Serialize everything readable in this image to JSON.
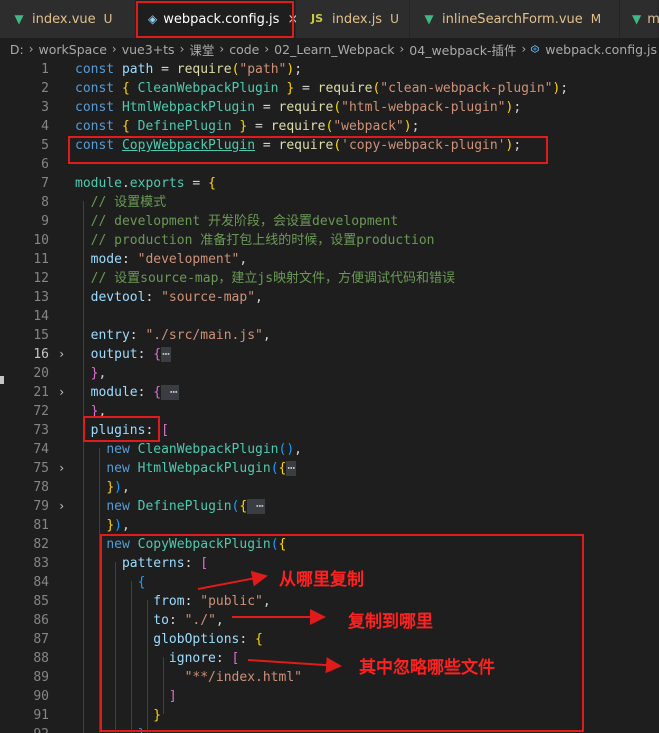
{
  "tabs": [
    {
      "icon": "vue-icon",
      "glyph": "▼",
      "color": "#41b883",
      "name": "index.vue",
      "badge": "U",
      "active": false
    },
    {
      "icon": "webpack-icon",
      "glyph": "◈",
      "color": "#8ed6fb",
      "name": "webpack.config.js",
      "badge": "",
      "close": "×",
      "active": true
    },
    {
      "icon": "js-icon",
      "glyph": "JS",
      "color": "#cbcb41",
      "name": "index.js",
      "badge": "U",
      "active": false
    },
    {
      "icon": "vue-icon",
      "glyph": "▼",
      "color": "#41b883",
      "name": "inlineSearchForm.vue",
      "badge": "M",
      "active": false
    },
    {
      "icon": "vue-icon",
      "glyph": "▼",
      "color": "#41b883",
      "name": "m",
      "badge": "",
      "active": false
    }
  ],
  "breadcrumb": [
    "D:",
    "workSpace",
    "vue3+ts",
    "课堂",
    "code",
    "02_Learn_Webpack",
    "04_webpack-插件",
    "webpack.config.js"
  ],
  "editor": {
    "lines": [
      {
        "n": "1",
        "tokens": [
          [
            "kw",
            "const "
          ],
          [
            "var",
            "path"
          ],
          [
            "pl",
            " = "
          ],
          [
            "fn",
            "require"
          ],
          [
            "br1",
            "("
          ],
          [
            "str",
            "\"path\""
          ],
          [
            "br1",
            ")"
          ],
          [
            "pl",
            ";"
          ]
        ]
      },
      {
        "n": "2",
        "tokens": [
          [
            "kw",
            "const "
          ],
          [
            "br1",
            "{ "
          ],
          [
            "cls",
            "CleanWebpackPlugin"
          ],
          [
            "br1",
            " }"
          ],
          [
            "pl",
            " = "
          ],
          [
            "fn",
            "require"
          ],
          [
            "br1",
            "("
          ],
          [
            "str",
            "\"clean-webpack-plugin\""
          ],
          [
            "br1",
            ")"
          ],
          [
            "pl",
            ";"
          ]
        ]
      },
      {
        "n": "3",
        "tokens": [
          [
            "kw",
            "const "
          ],
          [
            "cls",
            "HtmlWebpackPlugin"
          ],
          [
            "pl",
            " = "
          ],
          [
            "fn",
            "require"
          ],
          [
            "br1",
            "("
          ],
          [
            "str",
            "\"html-webpack-plugin\""
          ],
          [
            "br1",
            ")"
          ],
          [
            "pl",
            ";"
          ]
        ]
      },
      {
        "n": "4",
        "tokens": [
          [
            "kw",
            "const "
          ],
          [
            "br1",
            "{ "
          ],
          [
            "cls",
            "DefinePlugin"
          ],
          [
            "br1",
            " }"
          ],
          [
            "pl",
            " = "
          ],
          [
            "fn",
            "require"
          ],
          [
            "br1",
            "("
          ],
          [
            "str",
            "\"webpack\""
          ],
          [
            "br1",
            ")"
          ],
          [
            "pl",
            ";"
          ]
        ]
      },
      {
        "n": "5",
        "tokens": [
          [
            "kw",
            "const "
          ],
          [
            "cls ul",
            "CopyWebpackPlugin"
          ],
          [
            "pl",
            " = "
          ],
          [
            "fn",
            "require"
          ],
          [
            "br1",
            "("
          ],
          [
            "str",
            "'copy-webpack-plugin'"
          ],
          [
            "br1",
            ")"
          ],
          [
            "pl",
            ";"
          ]
        ]
      },
      {
        "n": "6",
        "tokens": []
      },
      {
        "n": "7",
        "tokens": [
          [
            "cls",
            "module"
          ],
          [
            "pl",
            "."
          ],
          [
            "cls",
            "exports"
          ],
          [
            "pl",
            " = "
          ],
          [
            "br1",
            "{"
          ]
        ]
      },
      {
        "n": "8",
        "tokens": [
          [
            "pl",
            "  "
          ],
          [
            "cm",
            "// 设置模式"
          ]
        ]
      },
      {
        "n": "9",
        "tokens": [
          [
            "pl",
            "  "
          ],
          [
            "cm",
            "// development 开发阶段，会设置development"
          ]
        ]
      },
      {
        "n": "10",
        "tokens": [
          [
            "pl",
            "  "
          ],
          [
            "cm",
            "// production 准备打包上线的时候，设置production"
          ]
        ]
      },
      {
        "n": "11",
        "tokens": [
          [
            "pl",
            "  "
          ],
          [
            "var",
            "mode"
          ],
          [
            "pl",
            ": "
          ],
          [
            "str",
            "\"development\""
          ],
          [
            "pl",
            ","
          ]
        ]
      },
      {
        "n": "12",
        "tokens": [
          [
            "pl",
            "  "
          ],
          [
            "cm",
            "// 设置source-map，建立js映射文件，方便调试代码和错误"
          ]
        ]
      },
      {
        "n": "13",
        "tokens": [
          [
            "pl",
            "  "
          ],
          [
            "var",
            "devtool"
          ],
          [
            "pl",
            ": "
          ],
          [
            "str",
            "\"source-map\""
          ],
          [
            "pl",
            ","
          ]
        ]
      },
      {
        "n": "14",
        "tokens": []
      },
      {
        "n": "15",
        "tokens": [
          [
            "pl",
            "  "
          ],
          [
            "var",
            "entry"
          ],
          [
            "pl",
            ": "
          ],
          [
            "str",
            "\"./src/main.js\""
          ],
          [
            "pl",
            ","
          ]
        ]
      },
      {
        "n": "16",
        "cur": true,
        "fold": true,
        "tokens": [
          [
            "pl",
            "  "
          ],
          [
            "var",
            "output"
          ],
          [
            "pl",
            ": "
          ],
          [
            "br2",
            "{"
          ],
          [
            "ell",
            "⋯"
          ]
        ]
      },
      {
        "n": "20",
        "tokens": [
          [
            "pl",
            "  "
          ],
          [
            "br2",
            "}"
          ],
          [
            "pl",
            ","
          ]
        ]
      },
      {
        "n": "21",
        "fold": true,
        "tokens": [
          [
            "pl",
            "  "
          ],
          [
            "var",
            "module"
          ],
          [
            "pl",
            ": "
          ],
          [
            "br2",
            "{"
          ],
          [
            "ell",
            " ⋯"
          ]
        ]
      },
      {
        "n": "72",
        "tokens": [
          [
            "pl",
            "  "
          ],
          [
            "br2",
            "}"
          ],
          [
            "pl",
            ","
          ]
        ]
      },
      {
        "n": "73",
        "tokens": [
          [
            "pl",
            "  "
          ],
          [
            "var",
            "plugins"
          ],
          [
            "pl",
            ": "
          ],
          [
            "br2",
            "["
          ]
        ]
      },
      {
        "n": "74",
        "tokens": [
          [
            "pl",
            "    "
          ],
          [
            "kw",
            "new "
          ],
          [
            "cls",
            "CleanWebpackPlugin"
          ],
          [
            "br3",
            "()"
          ],
          [
            "pl",
            ","
          ]
        ]
      },
      {
        "n": "75",
        "fold": true,
        "tokens": [
          [
            "pl",
            "    "
          ],
          [
            "kw",
            "new "
          ],
          [
            "cls",
            "HtmlWebpackPlugin"
          ],
          [
            "br3",
            "("
          ],
          [
            "br1",
            "{"
          ],
          [
            "ell",
            "⋯"
          ]
        ]
      },
      {
        "n": "78",
        "tokens": [
          [
            "pl",
            "    "
          ],
          [
            "br1",
            "}"
          ],
          [
            "br3",
            ")"
          ],
          [
            "pl",
            ","
          ]
        ]
      },
      {
        "n": "79",
        "fold": true,
        "tokens": [
          [
            "pl",
            "    "
          ],
          [
            "kw",
            "new "
          ],
          [
            "cls",
            "DefinePlugin"
          ],
          [
            "br3",
            "("
          ],
          [
            "br1",
            "{"
          ],
          [
            "ell",
            " ⋯"
          ]
        ]
      },
      {
        "n": "81",
        "tokens": [
          [
            "pl",
            "    "
          ],
          [
            "br1",
            "}"
          ],
          [
            "br3",
            ")"
          ],
          [
            "pl",
            ","
          ]
        ]
      },
      {
        "n": "82",
        "tokens": [
          [
            "pl",
            "    "
          ],
          [
            "kw",
            "new "
          ],
          [
            "cls",
            "CopyWebpackPlugin"
          ],
          [
            "br3",
            "("
          ],
          [
            "br1",
            "{"
          ]
        ]
      },
      {
        "n": "83",
        "tokens": [
          [
            "pl",
            "      "
          ],
          [
            "var",
            "patterns"
          ],
          [
            "pl",
            ": "
          ],
          [
            "br2",
            "["
          ]
        ]
      },
      {
        "n": "84",
        "tokens": [
          [
            "pl",
            "        "
          ],
          [
            "br3",
            "{"
          ]
        ]
      },
      {
        "n": "85",
        "tokens": [
          [
            "pl",
            "          "
          ],
          [
            "var",
            "from"
          ],
          [
            "pl",
            ": "
          ],
          [
            "str",
            "\"public\""
          ],
          [
            "pl",
            ","
          ]
        ]
      },
      {
        "n": "86",
        "tokens": [
          [
            "pl",
            "          "
          ],
          [
            "var",
            "to"
          ],
          [
            "pl",
            ": "
          ],
          [
            "str",
            "\"./\""
          ],
          [
            "pl",
            ","
          ]
        ]
      },
      {
        "n": "87",
        "tokens": [
          [
            "pl",
            "          "
          ],
          [
            "var",
            "globOptions"
          ],
          [
            "pl",
            ": "
          ],
          [
            "br1",
            "{"
          ]
        ]
      },
      {
        "n": "88",
        "tokens": [
          [
            "pl",
            "            "
          ],
          [
            "var",
            "ignore"
          ],
          [
            "pl",
            ": "
          ],
          [
            "br2",
            "["
          ]
        ]
      },
      {
        "n": "89",
        "tokens": [
          [
            "pl",
            "              "
          ],
          [
            "str",
            "\"**/index.html\""
          ]
        ]
      },
      {
        "n": "90",
        "tokens": [
          [
            "pl",
            "            "
          ],
          [
            "br2",
            "]"
          ]
        ]
      },
      {
        "n": "91",
        "tokens": [
          [
            "pl",
            "          "
          ],
          [
            "br1",
            "}"
          ]
        ]
      },
      {
        "n": "92",
        "tokens": [
          [
            "pl",
            "        "
          ],
          [
            "br3",
            "}"
          ]
        ]
      }
    ]
  },
  "annotations": {
    "from_note": "从哪里复制",
    "to_note": "复制到哪里",
    "ignore_note": "其中忽略哪些文件",
    "color": "#e01b1b"
  }
}
